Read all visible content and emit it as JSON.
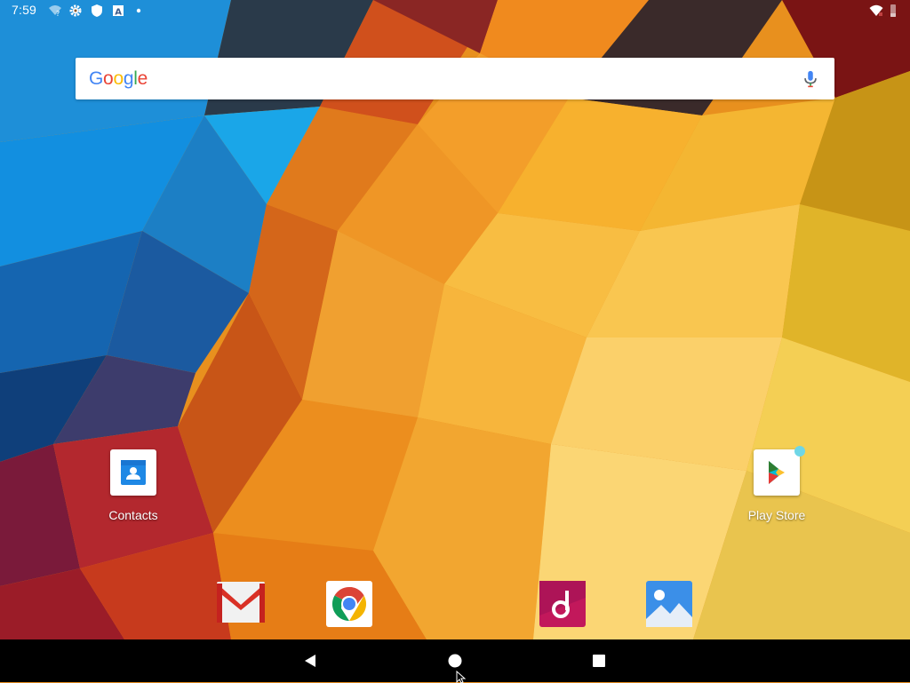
{
  "status_bar": {
    "time": "7:59",
    "left_icons": [
      "wifi-question-icon",
      "settings-gear-icon",
      "shield-icon",
      "a-badge-icon",
      "dot-icon"
    ],
    "right_icons": [
      "wifi-signal-icon",
      "battery-icon"
    ]
  },
  "search": {
    "logo": [
      "G",
      "o",
      "o",
      "g",
      "l",
      "e"
    ],
    "logo_colors": [
      "#4285F4",
      "#EA4335",
      "#FBBC05",
      "#4285F4",
      "#34A853",
      "#EA4335"
    ],
    "voice_icon": "mic-icon"
  },
  "home_apps": [
    {
      "label": "Contacts",
      "icon": "contacts-icon"
    },
    {
      "label": "Play Store",
      "icon": "play-store-icon"
    }
  ],
  "dock": [
    "gmail-icon",
    "chrome-icon",
    "music-icon",
    "photos-icon"
  ],
  "nav_bar": [
    "back-icon",
    "home-icon",
    "recents-icon"
  ],
  "colors": {
    "nav_bar_bg": "#000000",
    "search_bg": "#ffffff"
  }
}
